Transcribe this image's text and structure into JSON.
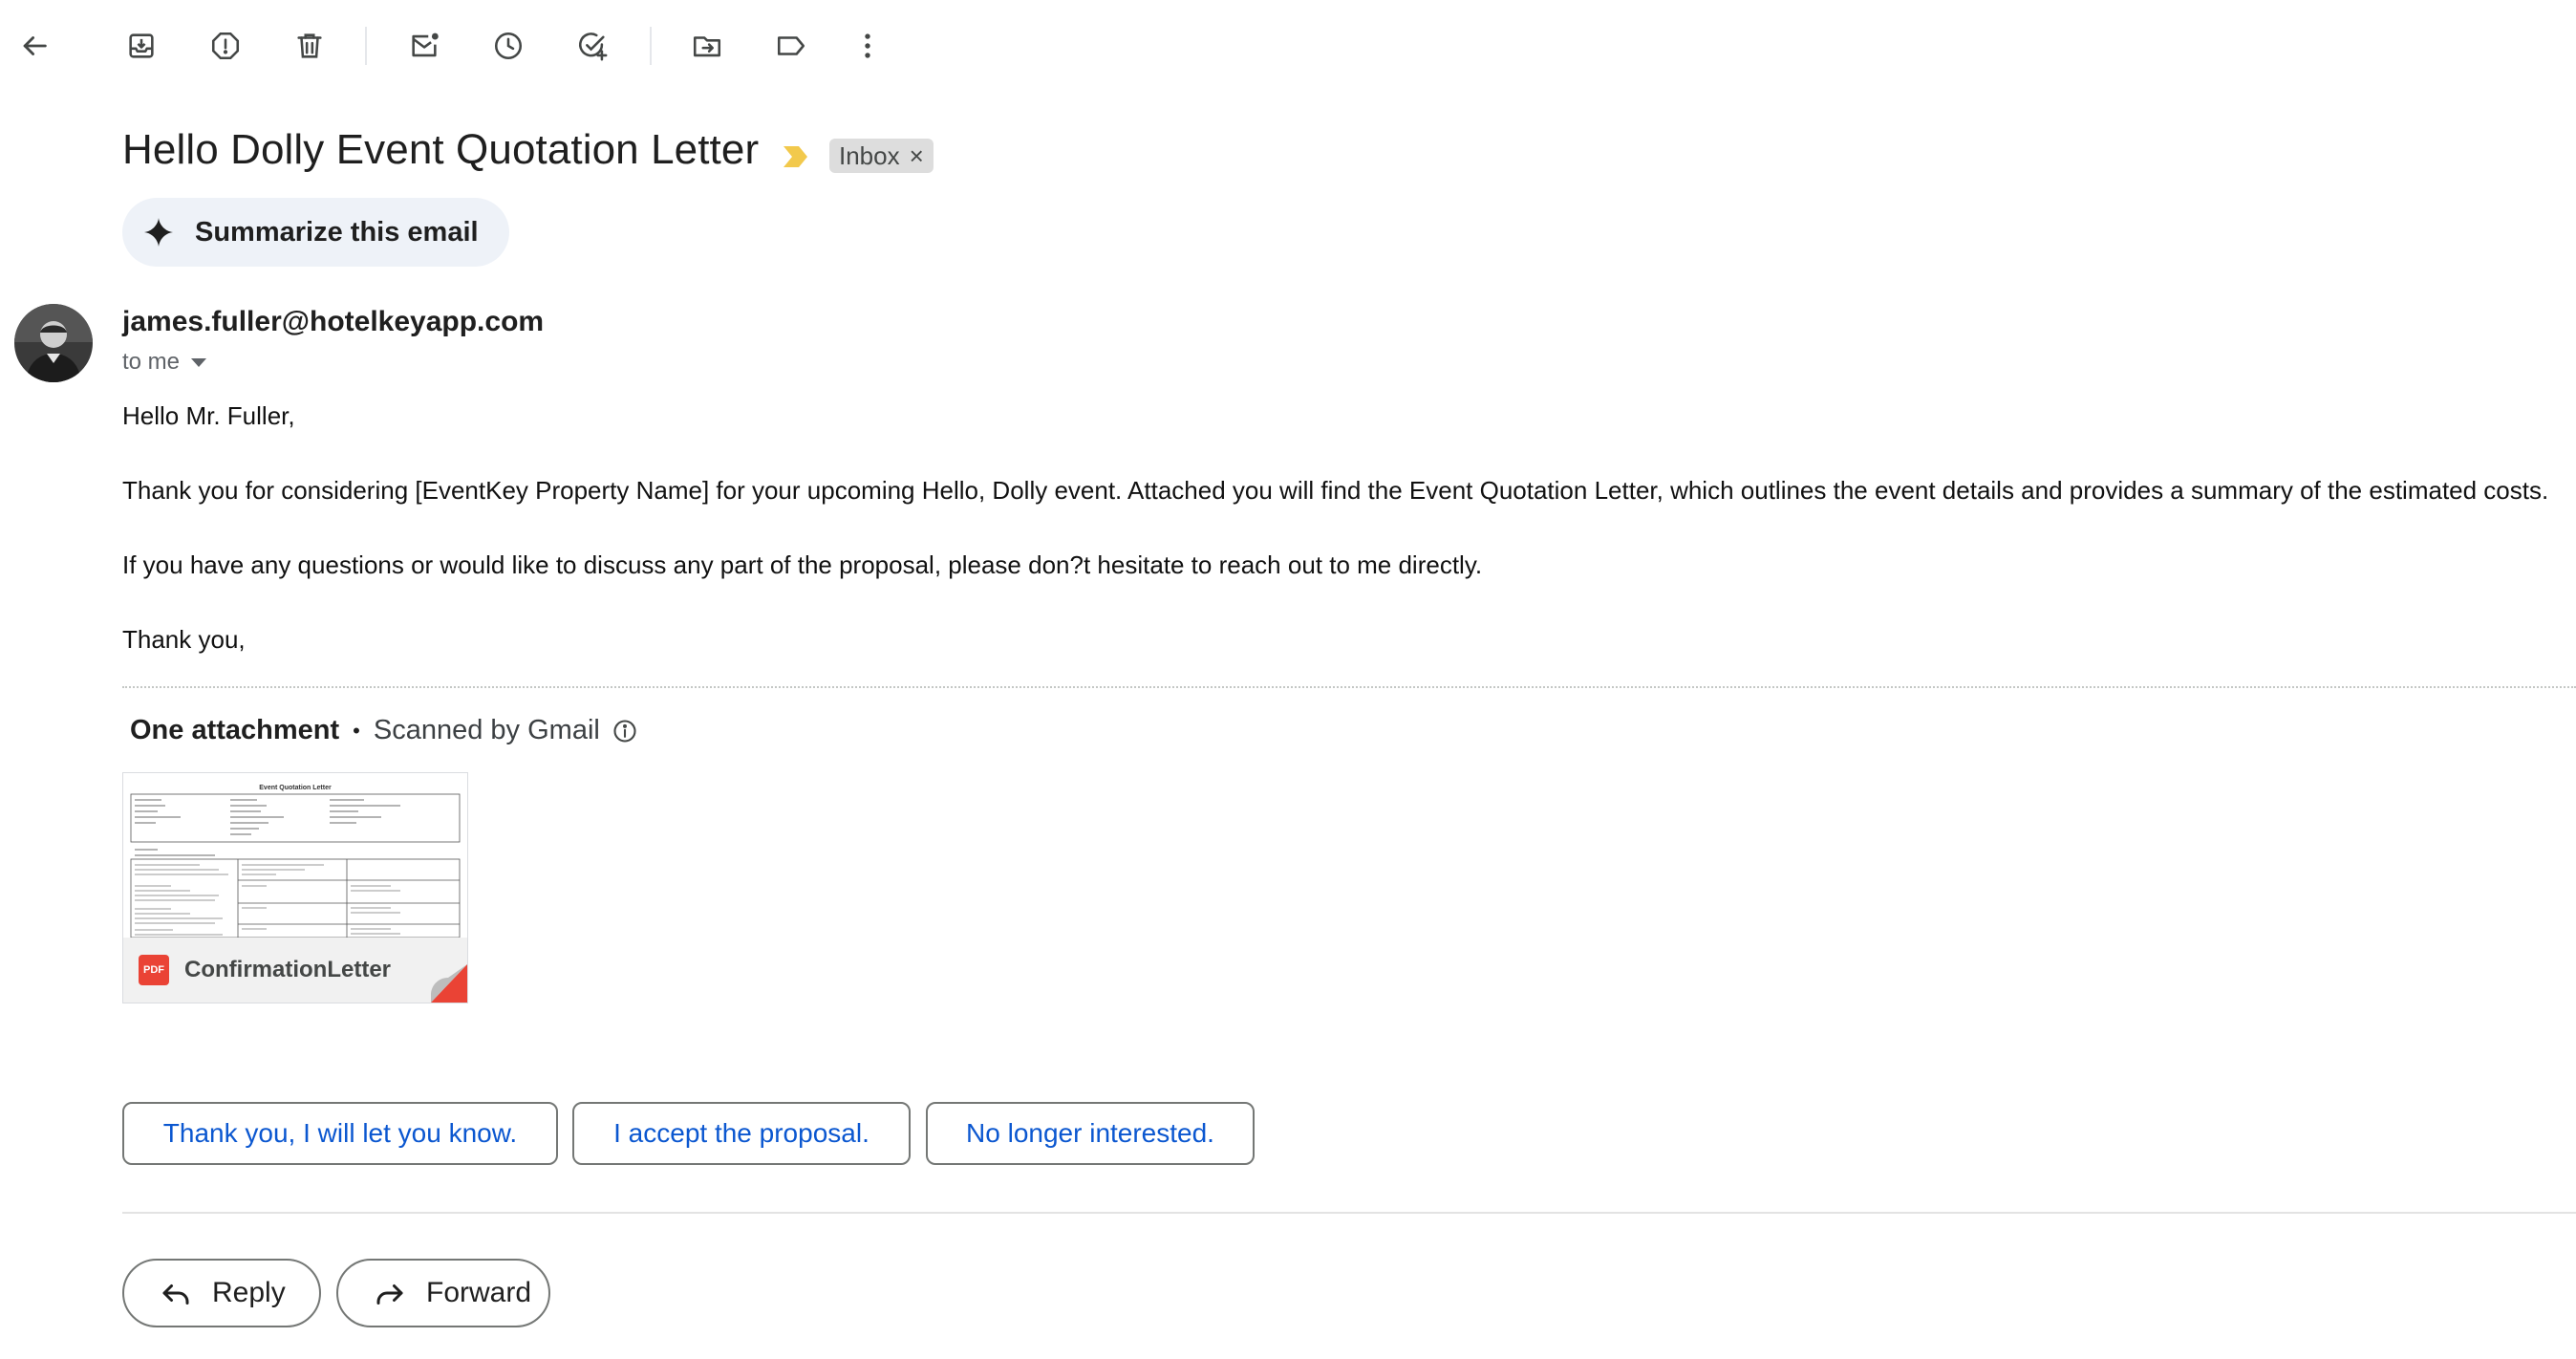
{
  "toolbar": {
    "icons": [
      "back-arrow-icon",
      "archive-icon",
      "report-spam-icon",
      "delete-icon",
      "mark-unread-icon",
      "snooze-icon",
      "add-to-tasks-icon",
      "move-to-icon",
      "labels-icon",
      "more-vert-icon"
    ]
  },
  "email": {
    "subject": "Hello Dolly Event Quotation Letter",
    "label": "Inbox",
    "label_remove": "×",
    "summarize_label": "Summarize this email",
    "sender": "james.fuller@hotelkeyapp.com",
    "recipient_line": "to me",
    "body": [
      "Hello Mr. Fuller,",
      "Thank you for considering [EventKey Property Name] for your upcoming Hello, Dolly event.  Attached you will find the Event Quotation Letter, which outlines the event details and provides a summary of the estimated costs.",
      "If you have any questions or would like to discuss any part of the proposal, please don?t hesitate to reach out to me directly.",
      "Thank you,"
    ]
  },
  "attachments": {
    "heading": "One attachment",
    "separator": "•",
    "scanned": "Scanned by Gmail",
    "preview_title": "Event Quotation Letter",
    "file_type": "PDF",
    "file_name": "ConfirmationLetter"
  },
  "smart_replies": [
    "Thank you, I will let you know.",
    "I accept the proposal.",
    "No longer interested."
  ],
  "actions": {
    "reply": "Reply",
    "forward": "Forward"
  },
  "colors": {
    "accent_blue": "#0b57d0",
    "important_marker": "#f2c94c",
    "pdf_red": "#ea4335"
  }
}
